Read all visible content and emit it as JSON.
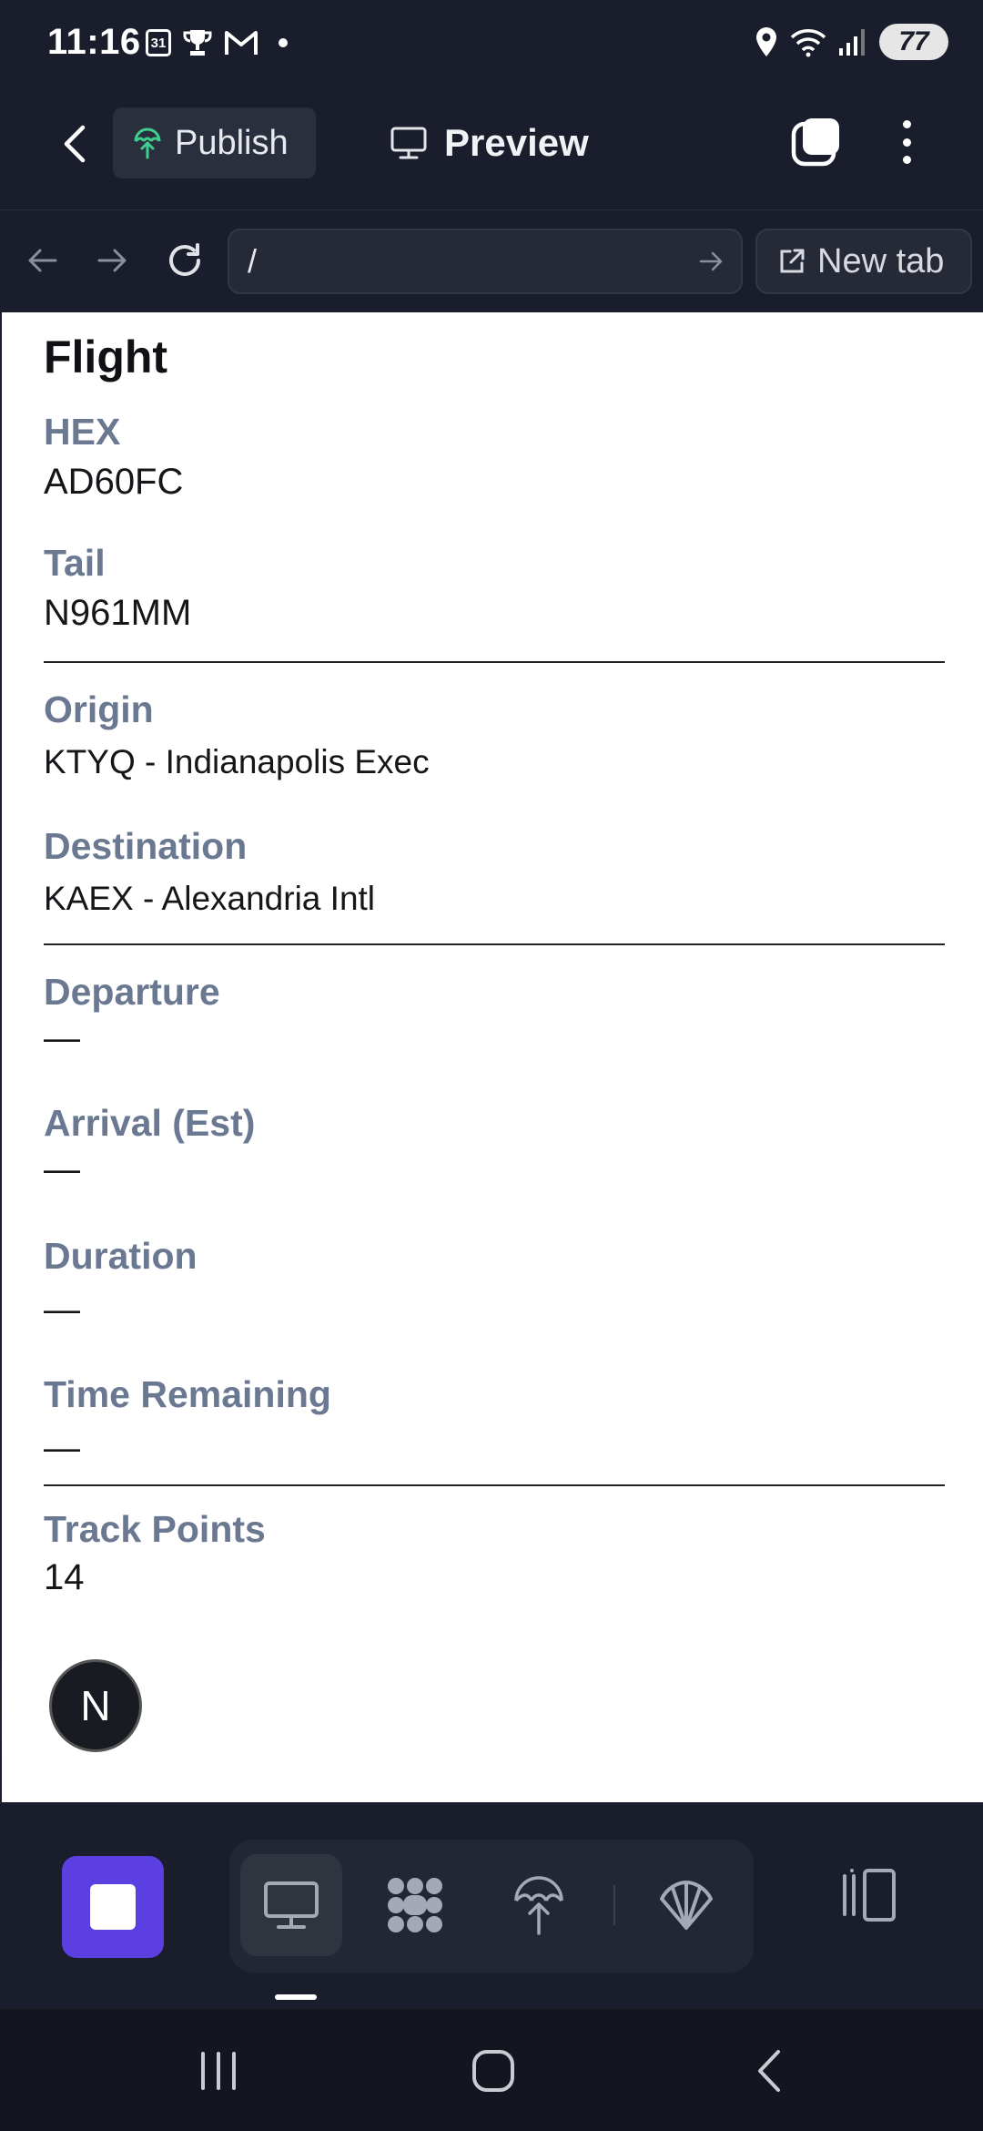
{
  "status_bar": {
    "time": "11:16",
    "calendar_date": "31",
    "battery": "77"
  },
  "toolbar": {
    "publish_label": "Publish",
    "preview_label": "Preview"
  },
  "browser": {
    "url": "/",
    "new_tab_label": "New tab"
  },
  "flight": {
    "title": "Flight",
    "groups": [
      [
        {
          "label": "HEX",
          "value": "AD60FC"
        },
        {
          "label": "Tail",
          "value": "N961MM"
        }
      ],
      [
        {
          "label": "Origin",
          "value": "KTYQ - Indianapolis Exec"
        },
        {
          "label": "Destination",
          "value": "KAEX - Alexandria Intl"
        }
      ],
      [
        {
          "label": "Departure",
          "value": "—"
        },
        {
          "label": "Arrival (Est)",
          "value": "—"
        },
        {
          "label": "Duration",
          "value": "—"
        },
        {
          "label": "Time Remaining",
          "value": "—"
        }
      ],
      [
        {
          "label": "Track Points",
          "value": "14"
        }
      ]
    ]
  },
  "floating_badge": {
    "letter": "N"
  },
  "colors": {
    "background": "#1a1e2c",
    "accent": "#5b3fe0",
    "label": "#6b7891",
    "publish_icon": "#3ecf8e"
  },
  "icons": {
    "status_left": [
      "calendar-icon",
      "trophy-icon",
      "gmail-icon",
      "notification-dot-icon"
    ],
    "status_right": [
      "location-icon",
      "wifi-icon",
      "signal-icon",
      "battery-icon"
    ],
    "dock_tools": [
      "monitor-icon",
      "nodes-icon",
      "deploy-icon",
      "shell-icon"
    ]
  }
}
